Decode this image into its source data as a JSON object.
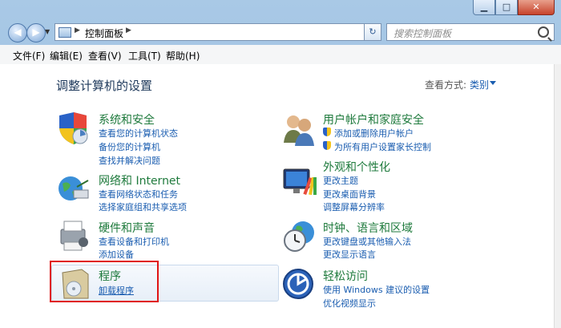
{
  "window": {
    "min_symbol": "▁",
    "max_symbol": "□",
    "close_symbol": "✕"
  },
  "address": {
    "path": "控制面板",
    "separator": "▶",
    "search_placeholder": "搜索控制面板"
  },
  "menu": [
    "文件(F)",
    "编辑(E)",
    "查看(V)",
    "工具(T)",
    "帮助(H)"
  ],
  "page": {
    "title": "调整计算机的设置",
    "view_label": "查看方式:",
    "view_value": "类别"
  },
  "categories": {
    "system": {
      "title": "系统和安全",
      "links": [
        "查看您的计算机状态",
        "备份您的计算机",
        "查找并解决问题"
      ]
    },
    "network": {
      "title": "网络和 Internet",
      "links": [
        "查看网络状态和任务",
        "选择家庭组和共享选项"
      ]
    },
    "hardware": {
      "title": "硬件和声音",
      "links": [
        "查看设备和打印机",
        "添加设备"
      ]
    },
    "programs": {
      "title": "程序",
      "links": [
        "卸载程序"
      ]
    },
    "users": {
      "title": "用户帐户和家庭安全",
      "links": [
        "添加或删除用户帐户",
        "为所有用户设置家长控制"
      ]
    },
    "appearance": {
      "title": "外观和个性化",
      "links": [
        "更改主题",
        "更改桌面背景",
        "调整屏幕分辨率"
      ]
    },
    "clock": {
      "title": "时钟、语言和区域",
      "links": [
        "更改键盘或其他输入法",
        "更改显示语言"
      ]
    },
    "ease": {
      "title": "轻松访问",
      "links": [
        "使用 Windows 建议的设置",
        "优化视频显示"
      ]
    }
  },
  "colors": {
    "category_title": "#1e7a3c",
    "link": "#1a5db0",
    "highlight": "#e01414"
  }
}
